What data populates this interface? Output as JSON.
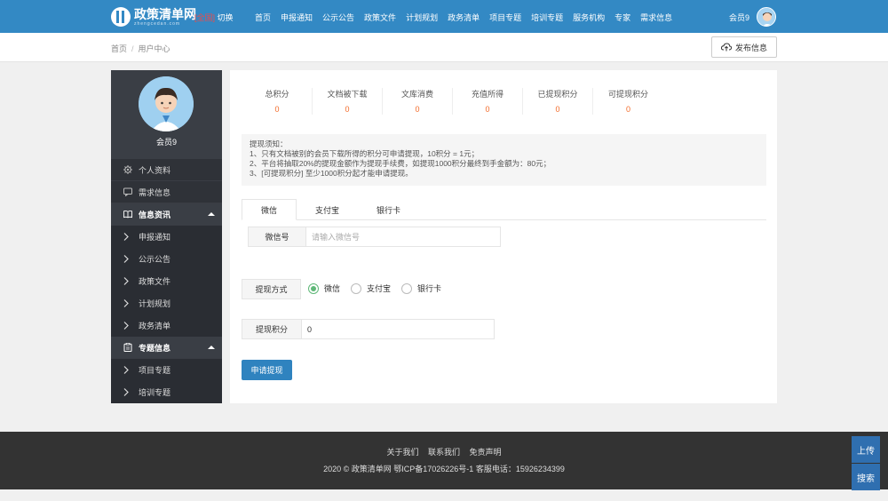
{
  "header": {
    "logo_cn": "政策清单网",
    "logo_en": "zhengcedan.com",
    "region_tag": "[全国]",
    "region_switch": "切换",
    "nav": [
      "首页",
      "申报通知",
      "公示公告",
      "政策文件",
      "计划规划",
      "政务清单",
      "项目专题",
      "培训专题",
      "服务机构",
      "专家",
      "需求信息"
    ],
    "user_name": "会员9"
  },
  "breadcrumb": {
    "home": "首页",
    "sep": "/",
    "current": "用户中心"
  },
  "publish_label": "发布信息",
  "sidebar": {
    "profile_name": "会员9",
    "items": [
      {
        "label": "个人资料",
        "icon": "gear-icon"
      },
      {
        "label": "需求信息",
        "icon": "chat-icon"
      }
    ],
    "group1": {
      "label": "信息资讯",
      "icon": "book-icon"
    },
    "group1_items": [
      "申报通知",
      "公示公告",
      "政策文件",
      "计划规划",
      "政务清单"
    ],
    "group2": {
      "label": "专题信息",
      "icon": "clipboard-icon"
    },
    "group2_items": [
      "项目专题",
      "培训专题"
    ]
  },
  "stats": [
    {
      "label": "总积分",
      "value": "0"
    },
    {
      "label": "文档被下载",
      "value": "0"
    },
    {
      "label": "文库消费",
      "value": "0"
    },
    {
      "label": "充值所得",
      "value": "0"
    },
    {
      "label": "已提现积分",
      "value": "0"
    },
    {
      "label": "可提现积分",
      "value": "0"
    }
  ],
  "notice": {
    "title": "提现须知：",
    "lines": [
      "1、只有文档被别的会员下载所得的积分可申请提现，10积分 = 1元；",
      "2、平台将抽取20%的提现金额作为提现手续费，如提现1000积分最终到手金额为：80元；",
      "3、[可提现积分] 至少1000积分起才能申请提现。"
    ]
  },
  "tabs": [
    "微信",
    "支付宝",
    "银行卡"
  ],
  "wechat_field": {
    "label": "微信号",
    "placeholder": "请输入微信号"
  },
  "method": {
    "label": "提现方式",
    "options": [
      "微信",
      "支付宝",
      "银行卡"
    ],
    "selected": "微信"
  },
  "points": {
    "label": "提现积分",
    "value": "0"
  },
  "submit_label": "申请提现",
  "footer": {
    "links": [
      "关于我们",
      "联系我们",
      "免责声明"
    ],
    "copyright": "2020 © 政策清单网 鄂ICP备17026226号-1 客服电话：15926234399"
  },
  "float": {
    "top": "上传",
    "search": "搜索"
  },
  "colors": {
    "header": "#3389c4",
    "sidebar": "#2f3238",
    "accent": "#2f83bf",
    "stat_value": "#f26b2a",
    "radio_on": "#5fb878"
  }
}
